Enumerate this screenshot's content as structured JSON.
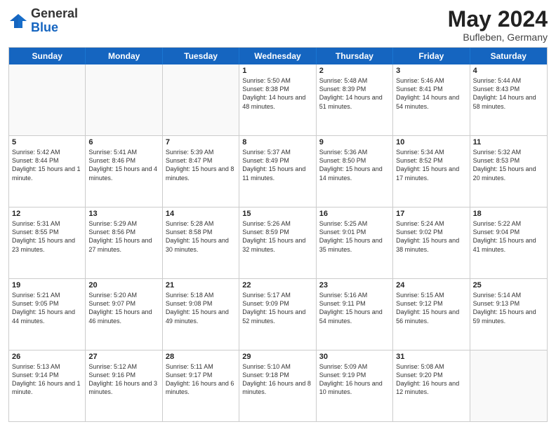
{
  "logo": {
    "general": "General",
    "blue": "Blue"
  },
  "title": {
    "month": "May 2024",
    "location": "Bufleben, Germany"
  },
  "weekdays": [
    "Sunday",
    "Monday",
    "Tuesday",
    "Wednesday",
    "Thursday",
    "Friday",
    "Saturday"
  ],
  "rows": [
    [
      {
        "day": "",
        "info": "",
        "empty": true
      },
      {
        "day": "",
        "info": "",
        "empty": true
      },
      {
        "day": "",
        "info": "",
        "empty": true
      },
      {
        "day": "1",
        "info": "Sunrise: 5:50 AM\nSunset: 8:38 PM\nDaylight: 14 hours and 48 minutes.",
        "empty": false
      },
      {
        "day": "2",
        "info": "Sunrise: 5:48 AM\nSunset: 8:39 PM\nDaylight: 14 hours and 51 minutes.",
        "empty": false
      },
      {
        "day": "3",
        "info": "Sunrise: 5:46 AM\nSunset: 8:41 PM\nDaylight: 14 hours and 54 minutes.",
        "empty": false
      },
      {
        "day": "4",
        "info": "Sunrise: 5:44 AM\nSunset: 8:43 PM\nDaylight: 14 hours and 58 minutes.",
        "empty": false
      }
    ],
    [
      {
        "day": "5",
        "info": "Sunrise: 5:42 AM\nSunset: 8:44 PM\nDaylight: 15 hours and 1 minute.",
        "empty": false
      },
      {
        "day": "6",
        "info": "Sunrise: 5:41 AM\nSunset: 8:46 PM\nDaylight: 15 hours and 4 minutes.",
        "empty": false
      },
      {
        "day": "7",
        "info": "Sunrise: 5:39 AM\nSunset: 8:47 PM\nDaylight: 15 hours and 8 minutes.",
        "empty": false
      },
      {
        "day": "8",
        "info": "Sunrise: 5:37 AM\nSunset: 8:49 PM\nDaylight: 15 hours and 11 minutes.",
        "empty": false
      },
      {
        "day": "9",
        "info": "Sunrise: 5:36 AM\nSunset: 8:50 PM\nDaylight: 15 hours and 14 minutes.",
        "empty": false
      },
      {
        "day": "10",
        "info": "Sunrise: 5:34 AM\nSunset: 8:52 PM\nDaylight: 15 hours and 17 minutes.",
        "empty": false
      },
      {
        "day": "11",
        "info": "Sunrise: 5:32 AM\nSunset: 8:53 PM\nDaylight: 15 hours and 20 minutes.",
        "empty": false
      }
    ],
    [
      {
        "day": "12",
        "info": "Sunrise: 5:31 AM\nSunset: 8:55 PM\nDaylight: 15 hours and 23 minutes.",
        "empty": false
      },
      {
        "day": "13",
        "info": "Sunrise: 5:29 AM\nSunset: 8:56 PM\nDaylight: 15 hours and 27 minutes.",
        "empty": false
      },
      {
        "day": "14",
        "info": "Sunrise: 5:28 AM\nSunset: 8:58 PM\nDaylight: 15 hours and 30 minutes.",
        "empty": false
      },
      {
        "day": "15",
        "info": "Sunrise: 5:26 AM\nSunset: 8:59 PM\nDaylight: 15 hours and 32 minutes.",
        "empty": false
      },
      {
        "day": "16",
        "info": "Sunrise: 5:25 AM\nSunset: 9:01 PM\nDaylight: 15 hours and 35 minutes.",
        "empty": false
      },
      {
        "day": "17",
        "info": "Sunrise: 5:24 AM\nSunset: 9:02 PM\nDaylight: 15 hours and 38 minutes.",
        "empty": false
      },
      {
        "day": "18",
        "info": "Sunrise: 5:22 AM\nSunset: 9:04 PM\nDaylight: 15 hours and 41 minutes.",
        "empty": false
      }
    ],
    [
      {
        "day": "19",
        "info": "Sunrise: 5:21 AM\nSunset: 9:05 PM\nDaylight: 15 hours and 44 minutes.",
        "empty": false
      },
      {
        "day": "20",
        "info": "Sunrise: 5:20 AM\nSunset: 9:07 PM\nDaylight: 15 hours and 46 minutes.",
        "empty": false
      },
      {
        "day": "21",
        "info": "Sunrise: 5:18 AM\nSunset: 9:08 PM\nDaylight: 15 hours and 49 minutes.",
        "empty": false
      },
      {
        "day": "22",
        "info": "Sunrise: 5:17 AM\nSunset: 9:09 PM\nDaylight: 15 hours and 52 minutes.",
        "empty": false
      },
      {
        "day": "23",
        "info": "Sunrise: 5:16 AM\nSunset: 9:11 PM\nDaylight: 15 hours and 54 minutes.",
        "empty": false
      },
      {
        "day": "24",
        "info": "Sunrise: 5:15 AM\nSunset: 9:12 PM\nDaylight: 15 hours and 56 minutes.",
        "empty": false
      },
      {
        "day": "25",
        "info": "Sunrise: 5:14 AM\nSunset: 9:13 PM\nDaylight: 15 hours and 59 minutes.",
        "empty": false
      }
    ],
    [
      {
        "day": "26",
        "info": "Sunrise: 5:13 AM\nSunset: 9:14 PM\nDaylight: 16 hours and 1 minute.",
        "empty": false
      },
      {
        "day": "27",
        "info": "Sunrise: 5:12 AM\nSunset: 9:16 PM\nDaylight: 16 hours and 3 minutes.",
        "empty": false
      },
      {
        "day": "28",
        "info": "Sunrise: 5:11 AM\nSunset: 9:17 PM\nDaylight: 16 hours and 6 minutes.",
        "empty": false
      },
      {
        "day": "29",
        "info": "Sunrise: 5:10 AM\nSunset: 9:18 PM\nDaylight: 16 hours and 8 minutes.",
        "empty": false
      },
      {
        "day": "30",
        "info": "Sunrise: 5:09 AM\nSunset: 9:19 PM\nDaylight: 16 hours and 10 minutes.",
        "empty": false
      },
      {
        "day": "31",
        "info": "Sunrise: 5:08 AM\nSunset: 9:20 PM\nDaylight: 16 hours and 12 minutes.",
        "empty": false
      },
      {
        "day": "",
        "info": "",
        "empty": true
      }
    ]
  ]
}
